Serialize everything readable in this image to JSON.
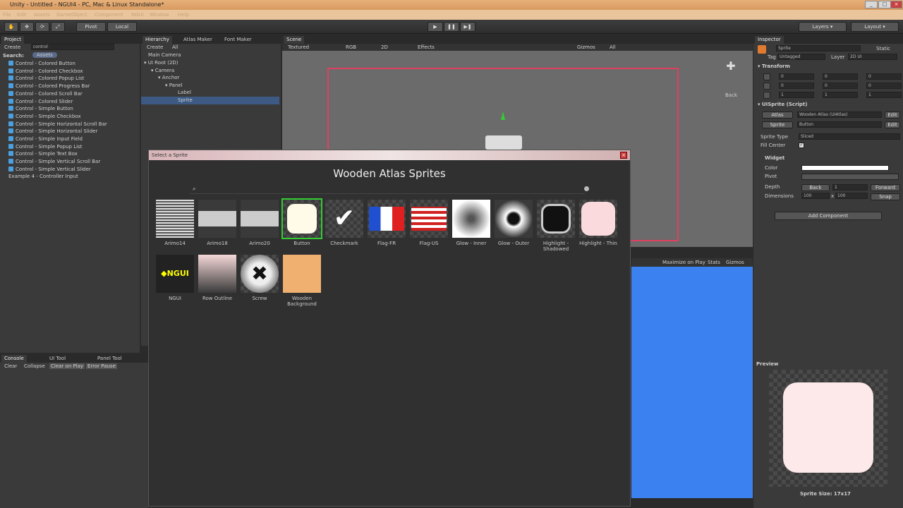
{
  "window": {
    "title": "Unity - Untitled - NGUI4 - PC, Mac & Linux Standalone*"
  },
  "menu": [
    "File",
    "Edit",
    "Assets",
    "GameObject",
    "Component",
    "NGUI",
    "Window",
    "Help"
  ],
  "toolbar": {
    "pivot": "Pivot",
    "local": "Local",
    "layers": "Layers",
    "layout": "Layout"
  },
  "project": {
    "tab": "Project",
    "create": "Create",
    "search_value": "control",
    "search_label": "Search:",
    "assets_label": "Assets",
    "items": [
      "Control - Colored Button",
      "Control - Colored Checkbox",
      "Control - Colored Popup List",
      "Control - Colored Progress Bar",
      "Control - Colored Scroll Bar",
      "Control - Colored Slider",
      "Control - Simple Button",
      "Control - Simple Checkbox",
      "Control - Simple Horizontal Scroll Bar",
      "Control - Simple Horizontal Slider",
      "Control - Simple Input Field",
      "Control - Simple Popup List",
      "Control - Simple Text Box",
      "Control - Simple Vertical Scroll Bar",
      "Control - Simple Vertical Slider"
    ],
    "scene_item": "Example 4 - Controller Input"
  },
  "hierarchy": {
    "tabs": [
      "Hierarchy",
      "Atlas Maker",
      "Font Maker"
    ],
    "create": "Create",
    "all": "All",
    "items": [
      "Main Camera",
      "UI Root (2D)",
      "Camera",
      "Anchor",
      "Panel",
      "Label",
      "Sprite"
    ]
  },
  "scene": {
    "tab": "Scene",
    "shading": "Textured",
    "rgb": "RGB",
    "mode2d": "2D",
    "effects": "Effects",
    "gizmos": "Gizmos",
    "all": "All",
    "back": "Back"
  },
  "game": {
    "maximize": "Maximize on Play",
    "stats": "Stats",
    "gizmos": "Gizmos"
  },
  "console": {
    "tabs": [
      "Console",
      "UI Tool",
      "Panel Tool"
    ],
    "buttons": [
      "Clear",
      "Collapse",
      "Clear on Play",
      "Error Pause"
    ]
  },
  "dialog": {
    "title": "Select a Sprite",
    "heading": "Wooden Atlas Sprites",
    "sprites": [
      {
        "label": "Arimo14"
      },
      {
        "label": "Arimo18"
      },
      {
        "label": "Arimo20"
      },
      {
        "label": "Button",
        "selected": true
      },
      {
        "label": "Checkmark"
      },
      {
        "label": "Flag-FR"
      },
      {
        "label": "Flag-US"
      },
      {
        "label": "Glow - Inner"
      },
      {
        "label": "Glow - Outer"
      },
      {
        "label": "Highlight - Shadowed"
      },
      {
        "label": "Highlight - Thin"
      },
      {
        "label": "NGUI"
      },
      {
        "label": "Row Outline"
      },
      {
        "label": "Screw"
      },
      {
        "label": "Wooden Background"
      }
    ]
  },
  "inspector": {
    "tab": "Inspector",
    "object_name": "Sprite",
    "static": "Static",
    "tag_label": "Tag",
    "tag_value": "Untagged",
    "layer_label": "Layer",
    "layer_value": "2D UI",
    "transform": "Transform",
    "p": {
      "x": "0",
      "y": "0",
      "z": "0"
    },
    "r": {
      "x": "0",
      "y": "0",
      "z": "0"
    },
    "s": {
      "x": "1",
      "y": "1",
      "z": "1"
    },
    "script": "UISprite (Script)",
    "atlas_label": "Atlas",
    "atlas_value": "Wooden Atlas (UIAtlas)",
    "sprite_label": "Sprite",
    "sprite_value": "Button",
    "edit": "Edit",
    "sprite_type_label": "Sprite Type",
    "sprite_type_value": "Sliced",
    "fill_center": "Fill Center",
    "widget": "Widget",
    "color": "Color",
    "pivot": "Pivot",
    "depth": "Depth",
    "depth_back": "Back",
    "depth_value": "1",
    "depth_forward": "Forward",
    "dimensions": "Dimensions",
    "dim_w": "100",
    "dim_x": "x",
    "dim_h": "100",
    "snap": "Snap",
    "add_component": "Add Component"
  },
  "preview": {
    "label": "Preview",
    "size": "Sprite Size: 17x17"
  },
  "colors": {
    "accent_blue": "#3b82f0",
    "selection_green": "#33cc33",
    "scene_frame": "#e04060"
  }
}
